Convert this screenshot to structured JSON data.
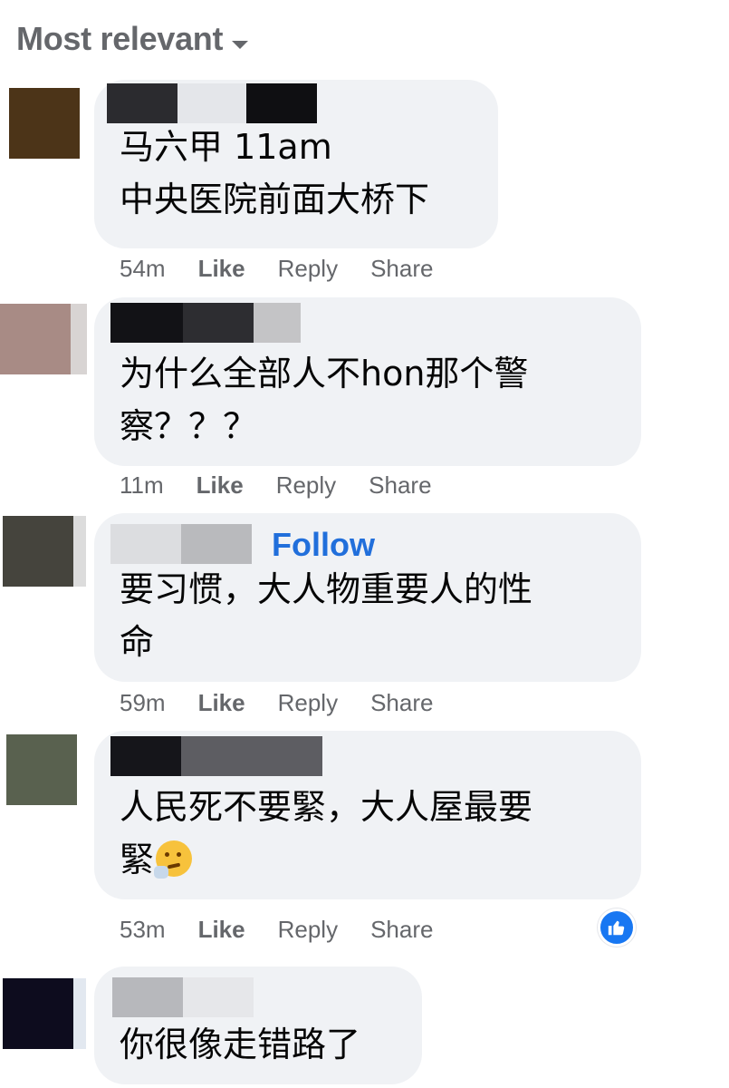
{
  "sort": {
    "label": "Most relevant"
  },
  "actions": {
    "like": "Like",
    "reply": "Reply",
    "share": "Share"
  },
  "comments": [
    {
      "time": "54m",
      "lines": [
        "马六甲 11am",
        "中央医院前面大桥下"
      ]
    },
    {
      "time": "11m",
      "lines": [
        "为什么全部人不hon那个警",
        "察？？？"
      ]
    },
    {
      "time": "59m",
      "follow": "Follow",
      "lines": [
        "要习惯，大人物重要人的性",
        "命"
      ]
    },
    {
      "time": "53m",
      "lines": [
        "人民死不要緊，大人屋最要",
        "緊"
      ],
      "emoji": "drooling-face-emoji",
      "reaction": "like-reaction-icon"
    },
    {
      "lines": [
        "你很像走错路了"
      ]
    }
  ],
  "colors": {
    "bubble": "#f0f2f5",
    "meta": "#65676b",
    "link": "#216fdb",
    "like_badge": "#1877f2"
  }
}
